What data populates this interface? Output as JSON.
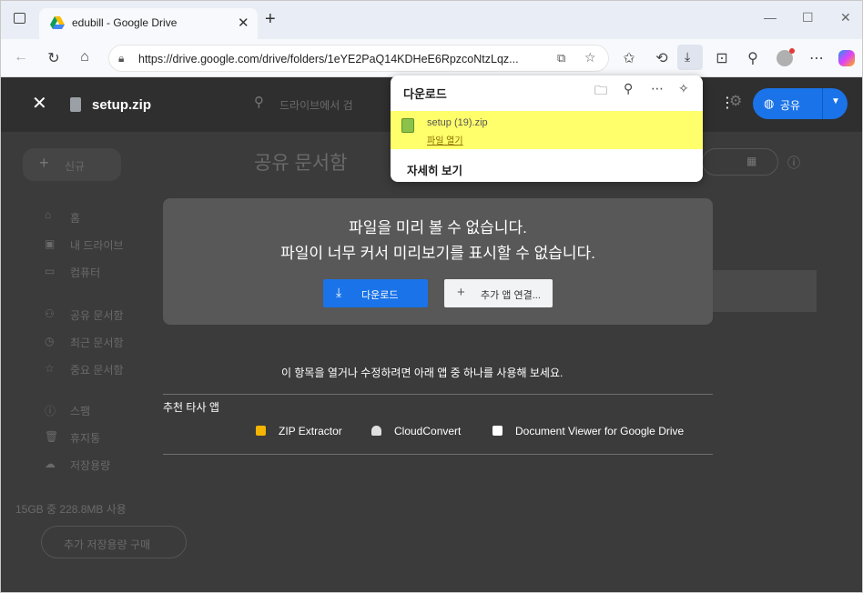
{
  "browser": {
    "tab_title": "edubill - Google Drive",
    "url": "https://drive.google.com/drive/folders/1eYE2PaQ14KDHeE6RpzcoNtzLqz...",
    "new_tab": "+",
    "minimize": "—",
    "maximize": "☐",
    "close": "✕"
  },
  "drive": {
    "file_name": "setup.zip",
    "search_placeholder": "드라이브에서 검",
    "share_label": "공유",
    "new_button": "신규",
    "folder_title": "공유 문서함",
    "sidebar": [
      "홈",
      "내 드라이브",
      "컴퓨터",
      "공유 문서함",
      "최근 문서함",
      "중요 문서함",
      "스팸",
      "휴지통",
      "저장용량"
    ],
    "storage": "15GB 중 228.8MB 사용",
    "buy_storage": "추가 저장용량 구매"
  },
  "preview": {
    "line1": "파일을 미리 볼 수 없습니다.",
    "line2": "파일이 너무 커서 미리보기를 표시할 수 없습니다.",
    "download_button": "다운로드",
    "connect_app_button": "추가 앱 연결...",
    "open_with": "이 항목을 열거나 수정하려면 아래 앱 중 하나를 사용해 보세요.",
    "recommended_label": "추천 타사 앱",
    "apps": [
      "ZIP Extractor",
      "CloudConvert",
      "Document Viewer for Google Drive"
    ]
  },
  "downloads_popup": {
    "title": "다운로드",
    "file_name": "setup (19).zip",
    "open_file": "파일 열기",
    "more_details": "자세히 보기"
  },
  "colors": {
    "accent": "#1a73e8",
    "highlight": "#ffff6b",
    "overlay": "#3b3b3b"
  }
}
